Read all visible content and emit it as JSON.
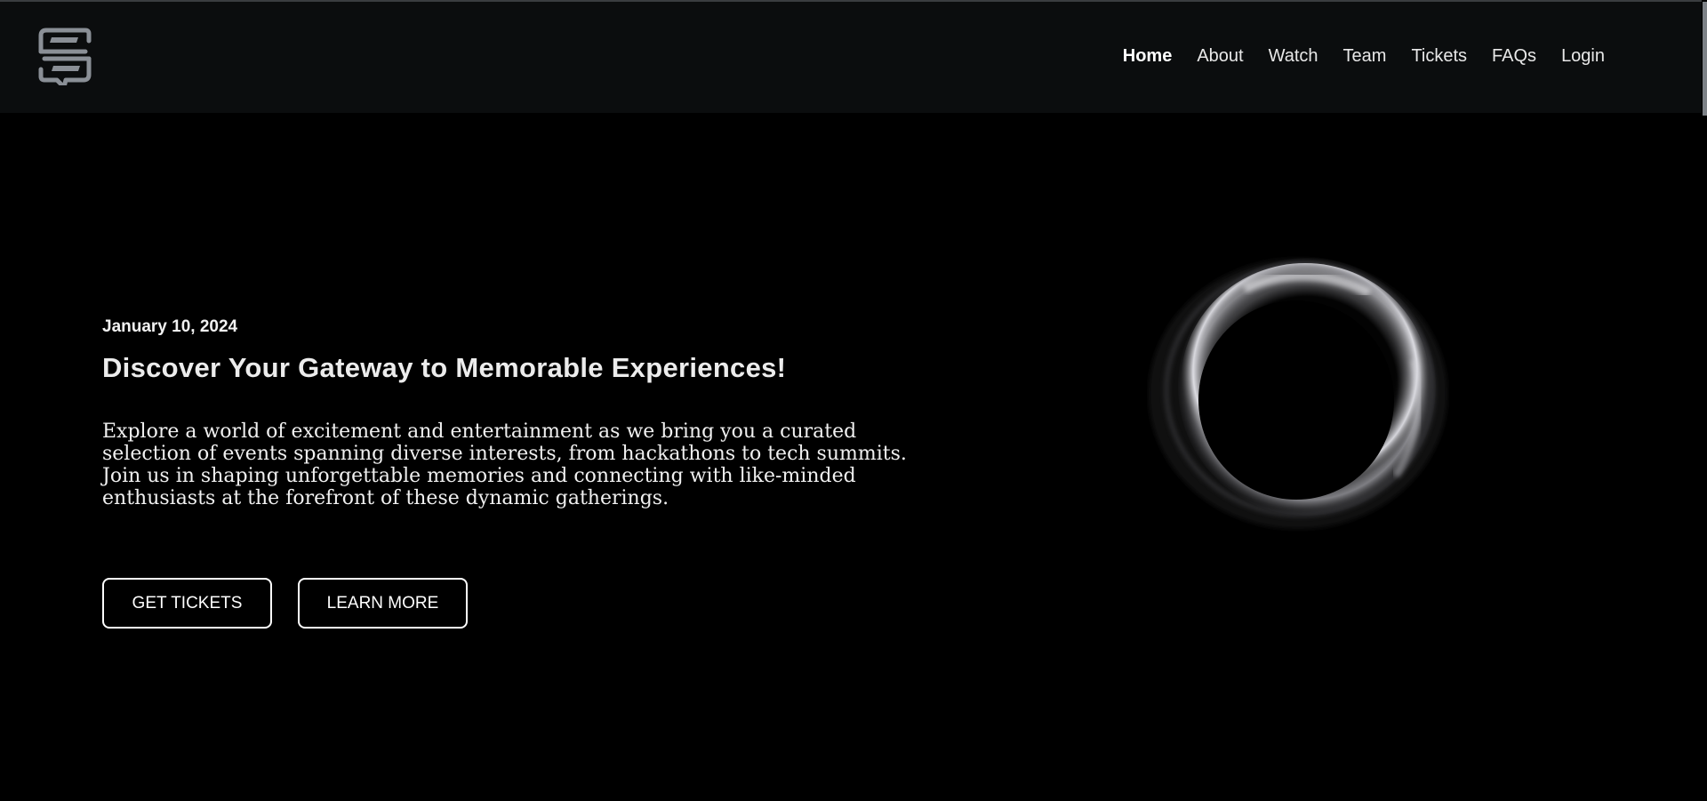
{
  "header": {
    "logo_icon": "speech-bubble-s-logo",
    "nav": [
      {
        "label": "Home",
        "active": true
      },
      {
        "label": "About",
        "active": false
      },
      {
        "label": "Watch",
        "active": false
      },
      {
        "label": "Team",
        "active": false
      },
      {
        "label": "Tickets",
        "active": false
      },
      {
        "label": "FAQs",
        "active": false
      },
      {
        "label": "Login",
        "active": false
      }
    ]
  },
  "hero": {
    "date": "January 10, 2024",
    "title": "Discover Your Gateway to Memorable Experiences!",
    "description": "Explore a world of excitement and entertainment as we bring you a curated selection of events spanning diverse interests, from hackathons to tech summits. Join us in shaping unforgettable memories and connecting with like-minded enthusiasts at the forefront of these dynamic gatherings.",
    "buttons": {
      "get_tickets": "GET TICKETS",
      "learn_more": "LEARN MORE"
    },
    "graphic_icon": "glowing-ring-orb"
  },
  "colors": {
    "header_bg": "#0b0d0e",
    "page_bg": "#000000",
    "text": "#ffffff",
    "logo": "#8a8f96"
  }
}
